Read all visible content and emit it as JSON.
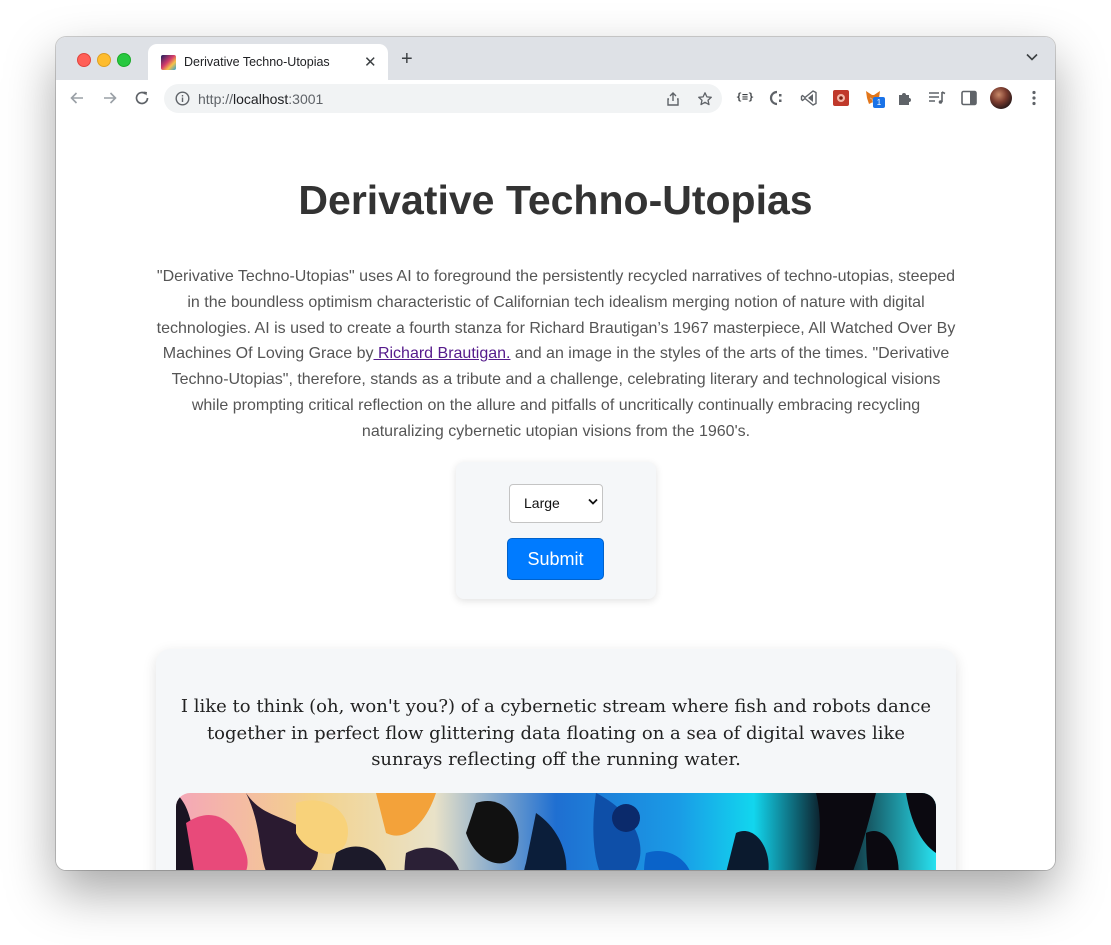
{
  "browser": {
    "tab_title": "Derivative Techno-Utopias",
    "url_scheme": "http://",
    "url_host": "localhost",
    "url_port": ":3001",
    "extension_badge": "1"
  },
  "page": {
    "title": "Derivative Techno-Utopias",
    "description_before_link": "\"Derivative Techno-Utopias\" uses AI to foreground the persistently recycled narratives of techno-utopias, steeped in the boundless optimism characteristic of Californian tech idealism merging notion of nature with digital technologies. AI is used to create a fourth stanza for Richard Brautigan’s 1967 masterpiece, All Watched Over By Machines Of Loving Grace by",
    "description_link": " Richard Brautigan.",
    "description_after_link": " and an image in the styles of the arts of the times. \"Derivative Techno-Utopias\", therefore, stands as a tribute and a challenge, celebrating literary and technological visions while prompting critical reflection on the allure and pitfalls of uncritically continually embracing recycling naturalizing cybernetic utopian visions from the 1960's.",
    "form": {
      "size_selected": "Large",
      "submit_label": "Submit"
    },
    "poem": "I like to think (oh, won't you?) of a cybernetic stream where fish and robots dance together in perfect flow glittering data floating on a sea of digital waves like sunrays reflecting off the running water."
  }
}
